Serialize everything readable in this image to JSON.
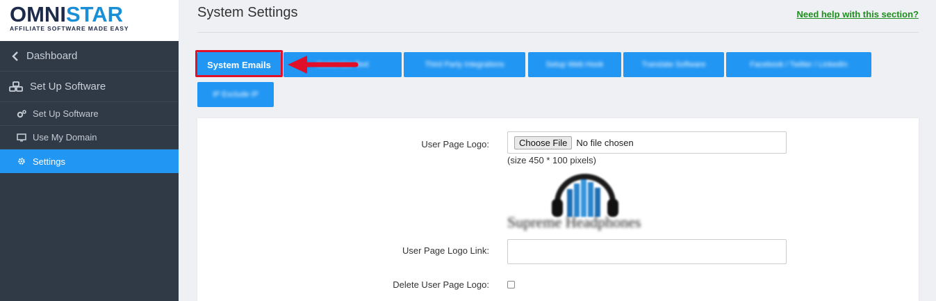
{
  "logo": {
    "brand_main": "OMNI",
    "brand_star": "STAR",
    "tagline": "AFFILIATE SOFTWARE MADE EASY"
  },
  "sidebar": {
    "dashboard": "Dashboard",
    "setup_section": "Set Up Software",
    "items": [
      {
        "label": "Set Up Software",
        "icon": "cogs-icon"
      },
      {
        "label": "Use My Domain",
        "icon": "monitor-icon"
      },
      {
        "label": "Settings",
        "icon": "gear-icon",
        "active": true
      }
    ]
  },
  "page": {
    "title": "System Settings",
    "help_link": "Need help with this section?"
  },
  "tabs": [
    {
      "label": "System Emails",
      "active": true
    },
    {
      "label": "Customize Text"
    },
    {
      "label": "Third Party Integrations"
    },
    {
      "label": "Setup Web Hook"
    },
    {
      "label": "Translate Software"
    },
    {
      "label": "Facebook / Twitter / LinkedIn"
    },
    {
      "label": "IP Exclude IP"
    }
  ],
  "form": {
    "logo_label": "User Page Logo:",
    "choose_file": "Choose File",
    "no_file": "No file chosen",
    "size_hint": "(size 450 * 100 pixels)",
    "logo_caption": "Supreme Headphones",
    "logo_link_label": "User Page Logo Link:",
    "logo_link_value": "",
    "delete_label": "Delete User Page Logo:",
    "delete_checked": false
  },
  "colors": {
    "accent": "#2196f3",
    "sidebar_bg": "#2f3a46",
    "highlight": "#e0102a",
    "help_link": "#1e8e1e"
  }
}
